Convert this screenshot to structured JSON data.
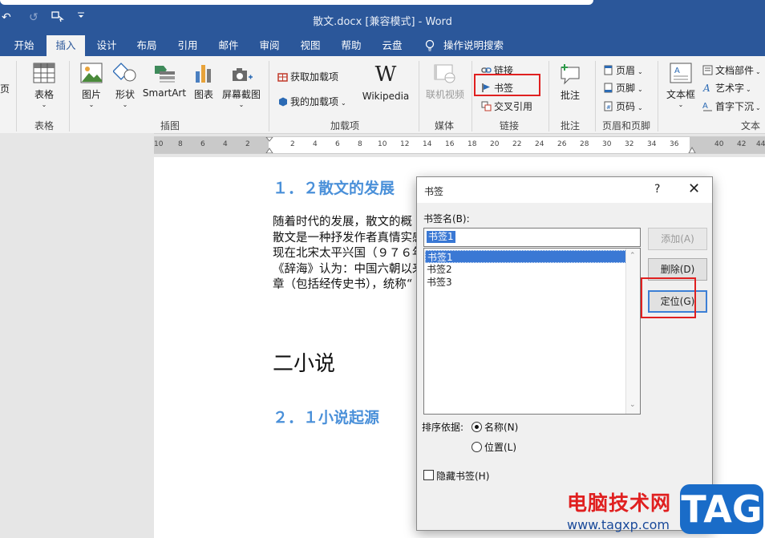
{
  "title_bar": {
    "title": "散文.docx [兼容模式]  -  Word",
    "undo_glyph": "↶",
    "redo_glyph": "↺"
  },
  "tabs": [
    "开始",
    "插入",
    "设计",
    "布局",
    "引用",
    "邮件",
    "审阅",
    "视图",
    "帮助",
    "云盘",
    "操作说明搜索"
  ],
  "active_tab": "插入",
  "ribbon": {
    "cut_off_left": "页",
    "table": {
      "button": "表格",
      "group": "表格"
    },
    "illustrations": {
      "buttons": [
        "图片",
        "形状",
        "SmartArt",
        "图表",
        "屏幕截图"
      ],
      "group": "插图"
    },
    "addins": {
      "get": "获取加载项",
      "my": "我的加载项",
      "wiki": "Wikipedia",
      "group": "加载项"
    },
    "media": {
      "button": "联机视频",
      "group": "媒体"
    },
    "links": {
      "link": "链接",
      "bookmark": "书签",
      "cross_ref": "交叉引用",
      "group": "链接"
    },
    "comments": {
      "button": "批注",
      "group": "批注"
    },
    "header_footer": {
      "header": "页眉",
      "footer": "页脚",
      "page_number": "页码",
      "group": "页眉和页脚"
    },
    "text": {
      "textbox": "文本框",
      "parts": "文档部件",
      "wordart": "艺术字",
      "dropcap": "首字下沉",
      "group": "文本"
    }
  },
  "ruler": [
    "10",
    "8",
    "6",
    "4",
    "2",
    "2",
    "4",
    "6",
    "8",
    "10",
    "12",
    "14",
    "16",
    "18",
    "20",
    "22",
    "24",
    "26",
    "28",
    "30",
    "32",
    "34",
    "36",
    "40",
    "42",
    "44"
  ],
  "document": {
    "heading_1_2": "１．２散文的发展",
    "paragraph_lines": [
      "随着时代的发展，散文的概",
      "散文是一种抒发作者真情实感",
      "现在北宋太平兴国（９７６年",
      "《辞海》认为：中国六朝以来",
      "章（包括经传史书），统称“"
    ],
    "heading_2": "二小说",
    "heading_2_1": "２．１小说起源"
  },
  "dialog": {
    "title": "书签",
    "help": "?",
    "close": "✕",
    "name_label": "书签名(B):",
    "name_value": "书签1",
    "bookmarks": [
      "书签1",
      "书签2",
      "书签3"
    ],
    "selected_index": 0,
    "buttons": {
      "add": "添加(A)",
      "delete": "删除(D)",
      "goto": "定位(G)"
    },
    "sort_label": "排序依据:",
    "sort_name": "名称(N)",
    "sort_location": "位置(L)",
    "sort_selected": "名称(N)",
    "hidden_label": "隐藏书签(H)",
    "hidden_checked": false
  },
  "watermark": {
    "site_name": "电脑技术网",
    "url": "www.tagxp.com",
    "tag": "TAG"
  },
  "colors": {
    "word_blue": "#2b579a",
    "heading_blue": "#4a90d9",
    "highlight_red": "#e02020",
    "selection": "#3a78d4"
  }
}
